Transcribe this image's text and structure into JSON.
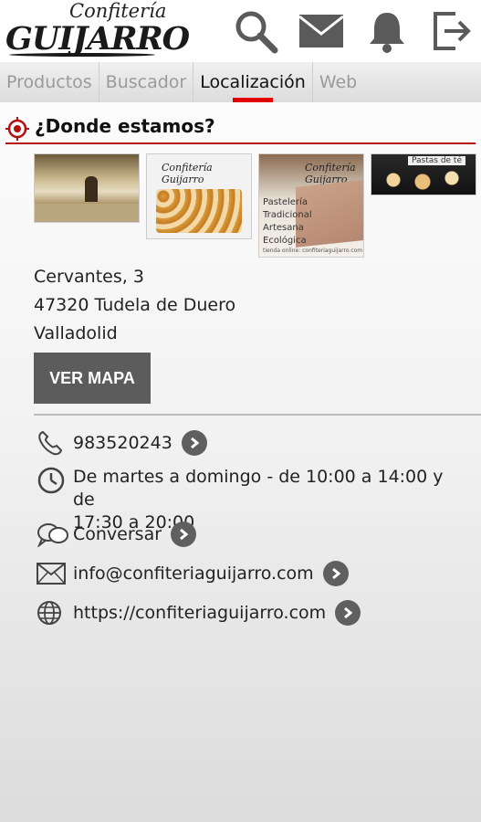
{
  "header": {
    "logo_sub": "Confitería",
    "logo_main": "GUIJARRO",
    "icons": [
      "search-icon",
      "mail-icon",
      "bell-icon",
      "exit-icon"
    ]
  },
  "tabs": [
    {
      "label": "Productos",
      "active": false
    },
    {
      "label": "Buscador",
      "active": false
    },
    {
      "label": "Localización",
      "active": true
    },
    {
      "label": "Web",
      "active": false
    }
  ],
  "section": {
    "title": "¿Donde estamos?"
  },
  "photos": {
    "p2_label": "Confitería Guijarro",
    "p3_label": "Confitería Guijarro",
    "p3_text": [
      "Pastelería",
      "Tradicional",
      "Artesana",
      "Ecológica"
    ],
    "p3_footer": "tienda online: confiteriaguijarro.com",
    "p4_label": "Pastas de té"
  },
  "address": {
    "line1": "Cervantes, 3",
    "line2": "47320 Tudela de Duero",
    "line3": "Valladolid"
  },
  "map_button": "VER MAPA",
  "contact": {
    "phone": "983520243",
    "hours_line1": "De martes a domingo - de 10:00 a 14:00 y de",
    "hours_line2": "17:30 a 20:00",
    "chat": "Conversar",
    "email": "info@confiteriaguijarro.com",
    "web": "https://confiteriaguijarro.com"
  },
  "colors": {
    "accent": "#e30000",
    "heading_rule": "#b01010",
    "button_bg": "#5c5c5c",
    "icon_gray": "#5f5f5f"
  }
}
